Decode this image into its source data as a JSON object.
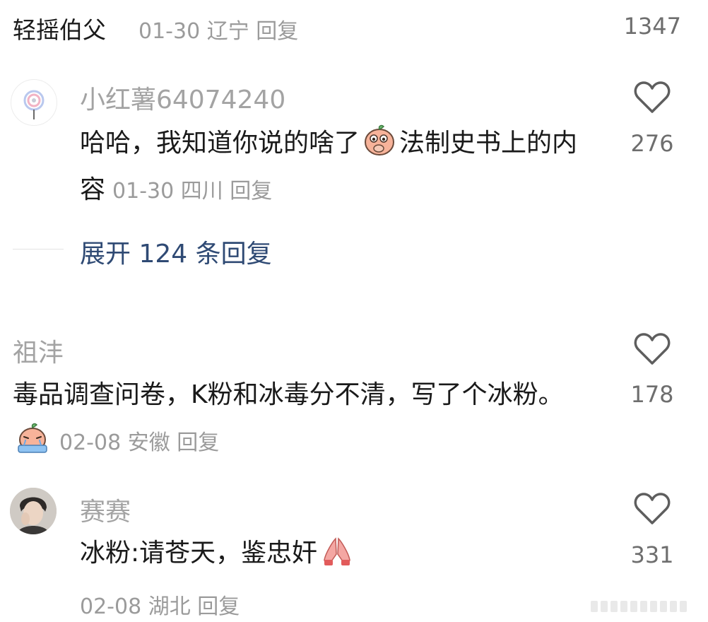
{
  "top_comment": {
    "username": "轻摇伯父",
    "date": "01-30",
    "location": "辽宁",
    "reply_label": "回复",
    "count": "1347"
  },
  "comments": [
    {
      "username": "小红薯64074240",
      "text_part1": "哈哈，我知道你说的啥了",
      "emoji_name": "peach-cover-mouth-emoji",
      "text_part2": "法制史书上的内容",
      "date": "01-30",
      "location": "四川",
      "reply_label": "回复",
      "likes": "276",
      "expand_label": "展开 124 条回复"
    },
    {
      "username": "祖沣",
      "text": "毒品调查问卷，K粉和冰毒分不清，写了个冰粉。",
      "emoji_name": "peach-crying-emoji",
      "date": "02-08",
      "location": "安徽",
      "reply_label": "回复",
      "likes": "178"
    },
    {
      "username": "赛赛",
      "text": "冰粉:请苍天，鉴忠奸",
      "emoji_name": "praying-hands-emoji",
      "date": "02-08",
      "location": "湖北",
      "reply_label": "回复",
      "likes": "331"
    }
  ],
  "icons": {
    "heart": "heart-outline-icon"
  },
  "colors": {
    "link": "#2f4a74",
    "meta": "#9b9b9b",
    "text": "#1a1a1a"
  }
}
